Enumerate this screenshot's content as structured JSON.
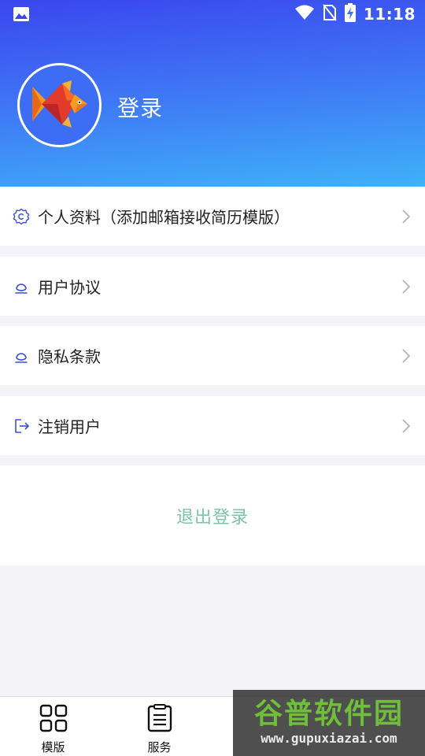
{
  "status_bar": {
    "time": "11:18",
    "left_icon": "image-icon",
    "right_icons": [
      "wifi-icon",
      "no-sim-icon",
      "battery-charging-icon"
    ]
  },
  "header": {
    "login_label": "登录",
    "avatar_icon": "fish-logo-icon"
  },
  "menu": [
    {
      "label": "个人资料（添加邮箱接收简历模版）",
      "icon": "settings-circle-icon"
    },
    {
      "label": "用户协议",
      "icon": "document-icon"
    },
    {
      "label": "隐私条款",
      "icon": "document-icon"
    },
    {
      "label": "注销用户",
      "icon": "sign-out-icon"
    }
  ],
  "logout_label": "退出登录",
  "bottom_nav": [
    {
      "label": "模版",
      "icon": "grid-icon"
    },
    {
      "label": "服务",
      "icon": "list-icon"
    },
    {
      "label": "",
      "icon": ""
    },
    {
      "label": "",
      "icon": ""
    }
  ],
  "watermark": {
    "top": "谷普软件园",
    "bottom": "www.gupuxiazai.com"
  },
  "colors": {
    "header_gradient_start": "#3a46ee",
    "header_gradient_end": "#3fb1f9",
    "logout_text": "#7cc4a8",
    "row_icon": "#3b4fd8"
  }
}
